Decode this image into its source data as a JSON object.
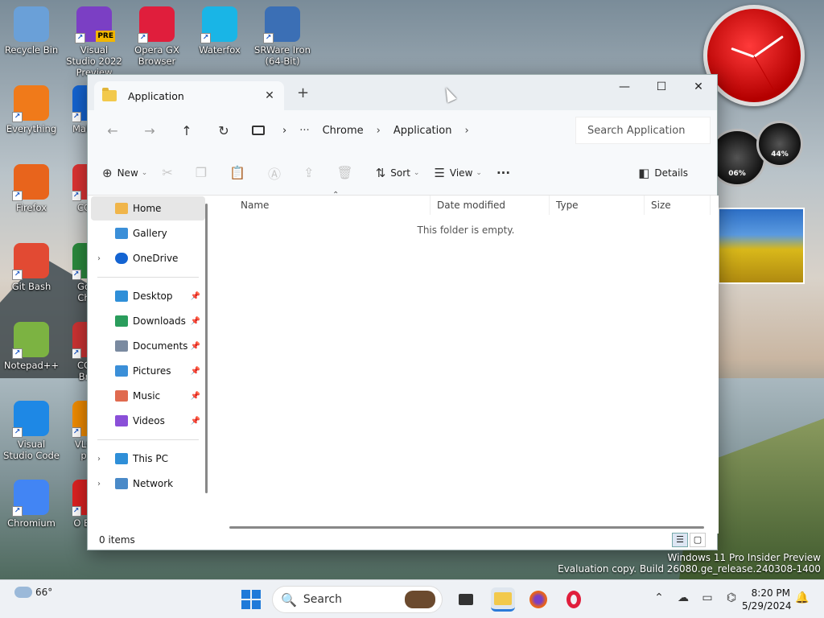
{
  "desktop": {
    "icons": [
      {
        "label": "Recycle Bin",
        "icon": "recycle-bin-icon",
        "color": "#6aa0d8"
      },
      {
        "label": "Visual Studio 2022 Preview",
        "icon": "visual-studio-icon",
        "color": "#7b3fc4",
        "badge": "PRE"
      },
      {
        "label": "Opera GX Browser",
        "icon": "opera-gx-icon",
        "color": "#e01e3c"
      },
      {
        "label": "Waterfox",
        "icon": "waterfox-icon",
        "color": "#19b5e6"
      },
      {
        "label": "SRWare Iron (64-Bit)",
        "icon": "srware-iron-icon",
        "color": "#3b6fb5"
      },
      {
        "label": "Everything",
        "icon": "everything-icon",
        "color": "#f07a1a"
      },
      {
        "label": "Malw",
        "icon": "malwarebytes-icon",
        "color": "#1464d2"
      },
      {
        "label": "Firefox",
        "icon": "firefox-icon",
        "color": "#e8641c"
      },
      {
        "label": "CC",
        "icon": "ccleaner-icon",
        "color": "#d33"
      },
      {
        "label": "Git Bash",
        "icon": "git-bash-icon",
        "color": "#e24a33"
      },
      {
        "label": "Go Ch",
        "icon": "chrome-icon",
        "color": "#2b8a3e"
      },
      {
        "label": "Notepad++",
        "icon": "notepad-plus-plus-icon",
        "color": "#7cb342"
      },
      {
        "label": "CC Br",
        "icon": "cc-browser-icon",
        "color": "#c33"
      },
      {
        "label": "Visual Studio Code",
        "icon": "vscode-icon",
        "color": "#1e88e5"
      },
      {
        "label": "VLC p",
        "icon": "vlc-icon",
        "color": "#f08c00"
      },
      {
        "label": "Chromium",
        "icon": "chromium-icon",
        "color": "#4285f4"
      },
      {
        "label": "O Br",
        "icon": "opera-icon",
        "color": "#d22"
      }
    ],
    "gadgets": {
      "cpu_meter": "06%",
      "mem_meter": "44%"
    }
  },
  "explorer": {
    "tab_title": "Application",
    "new_tab": "+",
    "window_controls": {
      "minimize": "—",
      "maximize": "☐",
      "close": "✕"
    },
    "nav": {
      "back": "←",
      "forward": "→",
      "up": "↑",
      "refresh": "↻"
    },
    "breadcrumb": {
      "more": "···",
      "items": [
        "Chrome",
        "Application"
      ]
    },
    "search_placeholder": "Search Application",
    "commands": {
      "new": "New",
      "sort": "Sort",
      "view": "View",
      "more": "···",
      "details": "Details"
    },
    "sidebar": {
      "home": "Home",
      "gallery": "Gallery",
      "onedrive": "OneDrive",
      "quick": [
        {
          "label": "Desktop",
          "color": "#2f8fd8"
        },
        {
          "label": "Downloads",
          "color": "#2a9d5c"
        },
        {
          "label": "Documents",
          "color": "#7a8aa0"
        },
        {
          "label": "Pictures",
          "color": "#3b8fd8"
        },
        {
          "label": "Music",
          "color": "#e06a4f"
        },
        {
          "label": "Videos",
          "color": "#8a4fd8"
        }
      ],
      "this_pc": "This PC",
      "network": "Network"
    },
    "columns": {
      "name": "Name",
      "date": "Date modified",
      "type": "Type",
      "size": "Size"
    },
    "empty_message": "This folder is empty.",
    "status": "0 items"
  },
  "watermark": {
    "line1": "Windows 11 Pro Insider Preview",
    "line2": "Evaluation copy. Build 26080.ge_release.240308-1400"
  },
  "taskbar": {
    "weather": "66°",
    "search": "Search",
    "time": "8:20 PM",
    "date": "5/29/2024"
  }
}
